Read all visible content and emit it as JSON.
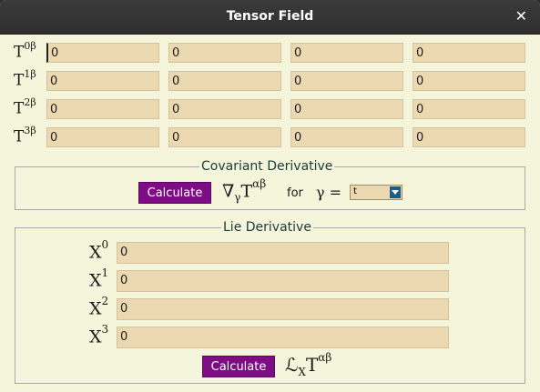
{
  "window": {
    "title": "Tensor Field"
  },
  "tensor": {
    "rows": [
      {
        "base": "T",
        "sup": "0β",
        "values": [
          "0",
          "0",
          "0",
          "0"
        ]
      },
      {
        "base": "T",
        "sup": "1β",
        "values": [
          "0",
          "0",
          "0",
          "0"
        ]
      },
      {
        "base": "T",
        "sup": "2β",
        "values": [
          "0",
          "0",
          "0",
          "0"
        ]
      },
      {
        "base": "T",
        "sup": "3β",
        "values": [
          "0",
          "0",
          "0",
          "0"
        ]
      }
    ]
  },
  "covariant": {
    "legend": "Covariant Derivative",
    "button": "Calculate",
    "nabla": "∇",
    "sub": "γ",
    "T": "T",
    "sup": "αβ",
    "for_label": "for",
    "gamma_eq": "γ =",
    "selected": "t"
  },
  "lie": {
    "legend": "Lie Derivative",
    "rows": [
      {
        "base": "X",
        "sup": "0",
        "value": "0"
      },
      {
        "base": "X",
        "sup": "1",
        "value": "0"
      },
      {
        "base": "X",
        "sup": "2",
        "value": "0"
      },
      {
        "base": "X",
        "sup": "3",
        "value": "0"
      }
    ],
    "button": "Calculate",
    "L": "ℒ",
    "sub": "X",
    "T": "T",
    "sup": "αβ"
  },
  "colors": {
    "accent": "#7d0c85",
    "field_bg": "#ecd9b2",
    "window_bg": "#f5f5dc"
  }
}
